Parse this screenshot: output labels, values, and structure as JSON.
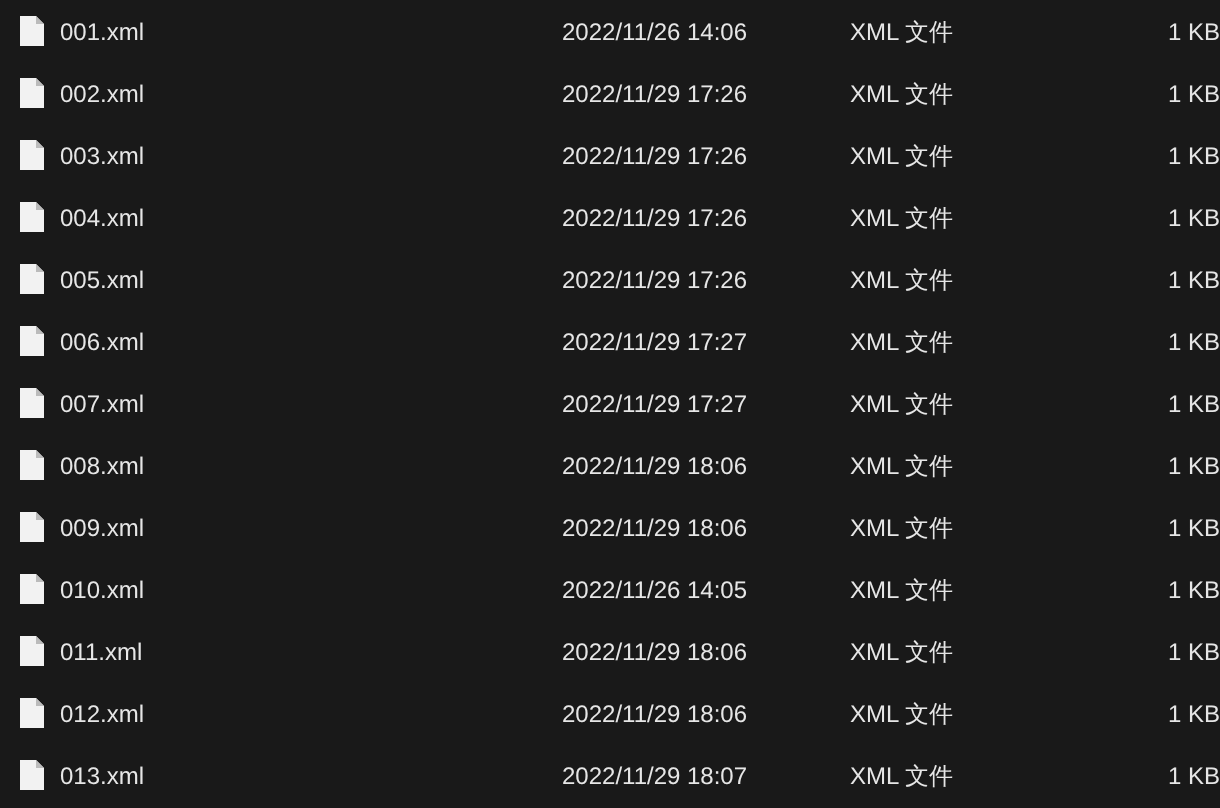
{
  "files": [
    {
      "name": "001.xml",
      "modified": "2022/11/26 14:06",
      "type": "XML 文件",
      "size": "1 KB"
    },
    {
      "name": "002.xml",
      "modified": "2022/11/29 17:26",
      "type": "XML 文件",
      "size": "1 KB"
    },
    {
      "name": "003.xml",
      "modified": "2022/11/29 17:26",
      "type": "XML 文件",
      "size": "1 KB"
    },
    {
      "name": "004.xml",
      "modified": "2022/11/29 17:26",
      "type": "XML 文件",
      "size": "1 KB"
    },
    {
      "name": "005.xml",
      "modified": "2022/11/29 17:26",
      "type": "XML 文件",
      "size": "1 KB"
    },
    {
      "name": "006.xml",
      "modified": "2022/11/29 17:27",
      "type": "XML 文件",
      "size": "1 KB"
    },
    {
      "name": "007.xml",
      "modified": "2022/11/29 17:27",
      "type": "XML 文件",
      "size": "1 KB"
    },
    {
      "name": "008.xml",
      "modified": "2022/11/29 18:06",
      "type": "XML 文件",
      "size": "1 KB"
    },
    {
      "name": "009.xml",
      "modified": "2022/11/29 18:06",
      "type": "XML 文件",
      "size": "1 KB"
    },
    {
      "name": "010.xml",
      "modified": "2022/11/26 14:05",
      "type": "XML 文件",
      "size": "1 KB"
    },
    {
      "name": "011.xml",
      "modified": "2022/11/29 18:06",
      "type": "XML 文件",
      "size": "1 KB"
    },
    {
      "name": "012.xml",
      "modified": "2022/11/29 18:06",
      "type": "XML 文件",
      "size": "1 KB"
    },
    {
      "name": "013.xml",
      "modified": "2022/11/29 18:07",
      "type": "XML 文件",
      "size": "1 KB"
    }
  ]
}
